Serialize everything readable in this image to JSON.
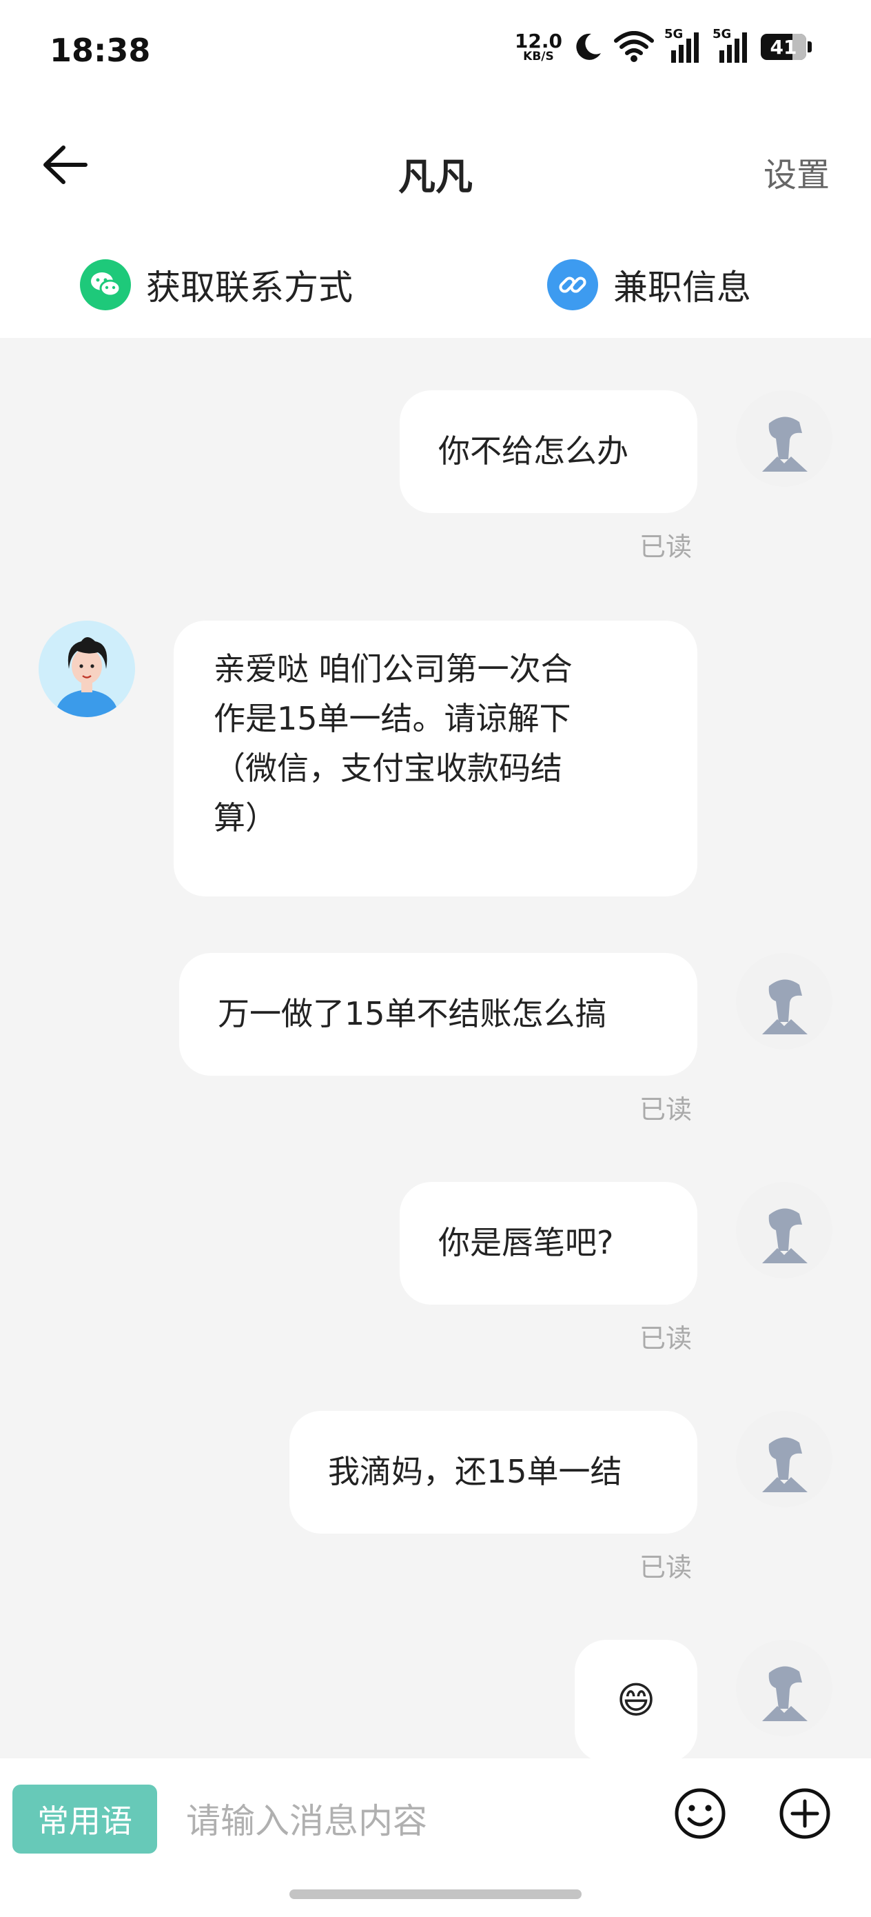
{
  "status_bar": {
    "time": "18:38",
    "net_speed": "12.0",
    "net_unit": "KB/S",
    "sig1": "5G",
    "sig2": "5G",
    "battery": "41"
  },
  "header": {
    "title": "凡凡",
    "settings": "设置"
  },
  "quick_actions": [
    {
      "label": "获取联系方式",
      "icon": "wechat-icon"
    },
    {
      "label": "兼职信息",
      "icon": "link-icon"
    }
  ],
  "messages": [
    {
      "from": "me",
      "text": "你不给怎么办",
      "read": "已读"
    },
    {
      "from": "other",
      "lines": [
        "亲爱哒 咱们公司第一次合",
        "作是15单一结。请谅解下",
        "（微信，支付宝收款码结",
        "算）"
      ]
    },
    {
      "from": "me",
      "text": "万一做了15单不结账怎么搞",
      "read": "已读"
    },
    {
      "from": "me",
      "text": "你是唇笔吧?",
      "read": "已读"
    },
    {
      "from": "me",
      "text": "我滴妈，还15单一结",
      "read": "已读"
    },
    {
      "from": "me",
      "text": "😄"
    }
  ],
  "input_bar": {
    "phrases": "常用语",
    "placeholder": "请输入消息内容"
  },
  "colors": {
    "accent": "#67c9b8",
    "wechat": "#1ec97a",
    "link": "#3d9bf0"
  }
}
